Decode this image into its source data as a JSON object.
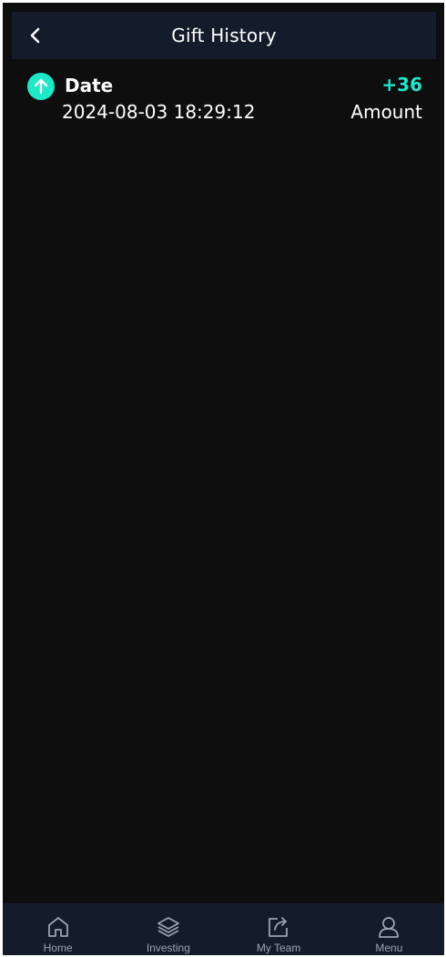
{
  "header": {
    "title": "Gift History",
    "back_icon": "chevron-left-icon"
  },
  "records": [
    {
      "icon": "arrow-up-icon",
      "date_label": "Date",
      "date_value": "2024-08-03 18:29:12",
      "amount_value": "+36",
      "amount_label": "Amount"
    }
  ],
  "nav": {
    "items": [
      {
        "label": "Home",
        "icon": "home-icon"
      },
      {
        "label": "Investing",
        "icon": "layers-icon"
      },
      {
        "label": "My Team",
        "icon": "share-icon"
      },
      {
        "label": "Menu",
        "icon": "user-icon"
      }
    ]
  },
  "colors": {
    "background": "#0e0e0f",
    "header_bg": "#141c2c",
    "accent": "#1de8c8",
    "nav_text": "#9aa3b2"
  }
}
